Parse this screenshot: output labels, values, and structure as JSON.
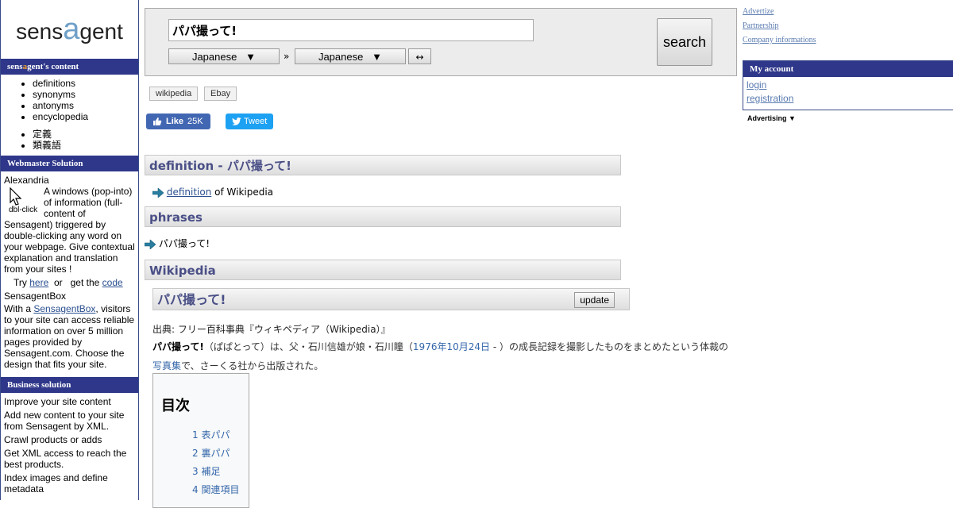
{
  "logo": {
    "pre": "sens",
    "accent": "a",
    "post": "gent"
  },
  "sidebar": {
    "content_head": {
      "pre": "sens",
      "accent": "a",
      "post": "gent's content"
    },
    "content_items": [
      "definitions",
      "synonyms",
      "antonyms",
      "encyclopedia"
    ],
    "content_items_ja": [
      "定義",
      "類義語"
    ],
    "webmaster_head": "Webmaster Solution",
    "alexandria_title": "Alexandria",
    "cursor_label": "dbl-click",
    "alexandria_text": "A windows (pop-into) of information (full-content of Sensagent) triggered by double-clicking any word on your webpage. Give contextual explanation and translation from your sites !",
    "try_text": "Try",
    "here_link": "here",
    "or_text": "or",
    "get_text": "get the",
    "code_link": "code",
    "box_title": "SensagentBox",
    "box_text_pre": "With a",
    "box_link": "SensagentBox",
    "box_text_post": ", visitors to your site can access reliable information on over 5 million pages provided by Sensagent.com. Choose the design that fits your site.",
    "business_head": "Business solution",
    "business_items": [
      "Improve your site content",
      "Add new content to your site from Sensagent by XML.",
      "Crawl products or adds",
      "Get XML access to reach the best products.",
      "Index images and define metadata"
    ]
  },
  "search": {
    "query": "パパ撮って!",
    "lang_from": "Japanese",
    "lang_to": "Japanese",
    "dropdown_arrow": "▼",
    "raquo": "»",
    "swap": "↔",
    "button": "search"
  },
  "tags": [
    "wikipedia",
    "Ebay"
  ],
  "social": {
    "like": "Like",
    "like_count": "25K",
    "tweet": "Tweet"
  },
  "sections": {
    "definition_head": "definition - パパ撮って!",
    "definition_link": "definition",
    "definition_suffix": " of Wikipedia",
    "phrases_head": "phrases",
    "phrase_item": "パパ撮って!",
    "wikipedia_head": "Wikipedia"
  },
  "wiki": {
    "title": "パパ撮って!",
    "update": "update",
    "source": "出典: フリー百科事典『ウィキペディア（Wikipedia）』",
    "bold_term": "パパ撮って!",
    "text1": "（ぱぱとって）は、父・石川信雄が娘・石川瞳（",
    "date_link": "1976年10月24日",
    "text2": " - ）の成長記録を撮影したものをまとめたという体裁の",
    "photo_link": "写真集",
    "text3": "で、さーくる社から出版された。",
    "toc_title": "目次",
    "toc_items": [
      "1 表パパ",
      "2 裏パパ",
      "3 補足",
      "4 関連項目"
    ]
  },
  "right": {
    "links": [
      "Advertize",
      "Partnership",
      "Company informations"
    ],
    "account_head": "My account",
    "login": "login",
    "registration": "registration",
    "advertising": "Advertising ▼"
  },
  "colors": {
    "sidebar_header": "#2e3789",
    "accent_orange": "#f0a030",
    "section_title": "#4a4f86",
    "facebook": "#4267b2",
    "twitter": "#1da1f2"
  }
}
